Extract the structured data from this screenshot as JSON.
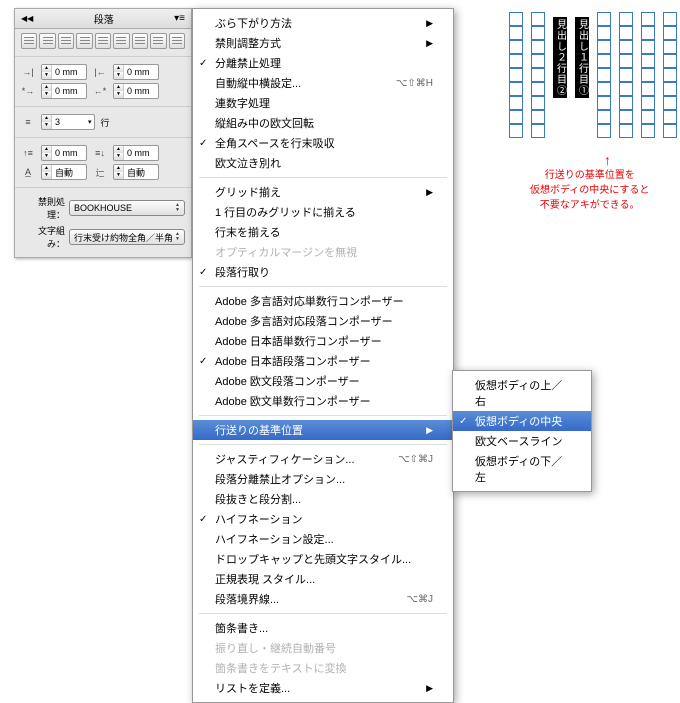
{
  "panel": {
    "title": "段落",
    "fields": {
      "i1": "0 mm",
      "i2": "0 mm",
      "i3": "0 mm",
      "i4": "0 mm",
      "lines": "3",
      "unit": "行",
      "d1": "0 mm",
      "d2": "0 mm",
      "a1": "自動",
      "a2": "自動"
    },
    "kinsoku_lbl": "禁則処理：",
    "kinsoku_val": "BOOKHOUSE",
    "mojikumi_lbl": "文字組み：",
    "mojikumi_val": "行末受け約物全角／半角"
  },
  "menu": [
    {
      "t": "ぶら下がり方法",
      "arr": true
    },
    {
      "t": "禁則調整方式",
      "arr": true
    },
    {
      "t": "分離禁止処理",
      "ck": true
    },
    {
      "t": "自動縦中横設定...",
      "sc": "⌥⇧⌘H"
    },
    {
      "t": "連数字処理"
    },
    {
      "t": "縦組み中の欧文回転"
    },
    {
      "t": "全角スペースを行末吸収",
      "ck": true
    },
    {
      "t": "欧文泣き別れ"
    },
    {
      "sep": true
    },
    {
      "t": "グリッド揃え",
      "arr": true
    },
    {
      "t": "1 行目のみグリッドに揃える"
    },
    {
      "t": "行末を揃える"
    },
    {
      "t": "オプティカルマージンを無視",
      "dis": true
    },
    {
      "t": "段落行取り",
      "ck": true
    },
    {
      "sep": true
    },
    {
      "t": "Adobe 多言語対応単数行コンポーザー"
    },
    {
      "t": "Adobe 多言語対応段落コンポーザー"
    },
    {
      "t": "Adobe 日本語単数行コンポーザー"
    },
    {
      "t": "Adobe 日本語段落コンポーザー",
      "ck": true
    },
    {
      "t": "Adobe 欧文段落コンポーザー"
    },
    {
      "t": "Adobe 欧文単数行コンポーザー"
    },
    {
      "sep": true
    },
    {
      "t": "行送りの基準位置",
      "arr": true,
      "hov": true
    },
    {
      "sep": true
    },
    {
      "t": "ジャスティフィケーション...",
      "sc": "⌥⇧⌘J"
    },
    {
      "t": "段落分離禁止オプション..."
    },
    {
      "t": "段抜きと段分割..."
    },
    {
      "t": "ハイフネーション",
      "ck": true
    },
    {
      "t": "ハイフネーション設定..."
    },
    {
      "t": "ドロップキャップと先頭文字スタイル..."
    },
    {
      "t": "正規表現 スタイル..."
    },
    {
      "t": "段落境界線...",
      "sc": "⌥⌘J"
    },
    {
      "sep": true
    },
    {
      "t": "箇条書き..."
    },
    {
      "t": "振り直し・継続自動番号",
      "dis": true
    },
    {
      "t": "箇条書きをテキストに変換",
      "dis": true
    },
    {
      "t": "リストを定義...",
      "arr": true
    }
  ],
  "sub": [
    {
      "t": "仮想ボディの上／右"
    },
    {
      "t": "仮想ボディの中央",
      "ck": true,
      "hov": true
    },
    {
      "t": "欧文ベースライン"
    },
    {
      "t": "仮想ボディの下／左"
    }
  ],
  "sample": {
    "h1": "見出し１行目①",
    "h2": "見出し２行目②"
  },
  "caption": {
    "l1": "行送りの基準位置を",
    "l2": "仮想ボディの中央にすると",
    "l3": "不要なアキができる。"
  }
}
